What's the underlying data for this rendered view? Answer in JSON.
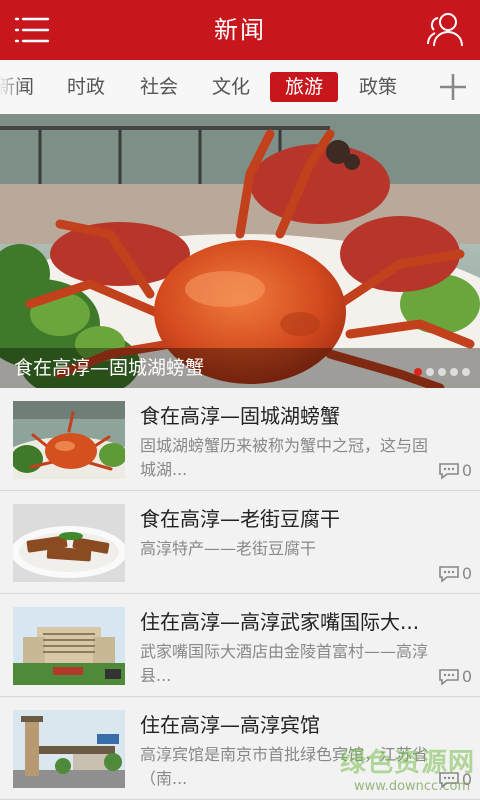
{
  "header": {
    "title": "新闻"
  },
  "tabs": [
    {
      "label": "新闻"
    },
    {
      "label": "时政"
    },
    {
      "label": "社会"
    },
    {
      "label": "文化"
    },
    {
      "label": "旅游",
      "active": true
    },
    {
      "label": "政策"
    }
  ],
  "banner": {
    "caption": "食在高淳—固城湖螃蟹",
    "slide_count": 5,
    "active_slide": 1
  },
  "articles": [
    {
      "title": "食在高淳—固城湖螃蟹",
      "summary": "固城湖螃蟹历来被称为蟹中之冠，这与固城湖...",
      "comments": "0",
      "thumb": "crab-dish"
    },
    {
      "title": "食在高淳—老街豆腐干",
      "summary": "高淳特产——老街豆腐干",
      "comments": "0",
      "thumb": "tofu-dish"
    },
    {
      "title": "住在高淳—高淳武家嘴国际大...",
      "summary": " 武家嘴国际大酒店由金陵首富村——高淳县...",
      "comments": "0",
      "thumb": "hotel-building"
    },
    {
      "title": "住在高淳—高淳宾馆",
      "summary": "高淳宾馆是南京市首批绿色宾馆，江苏省（南...",
      "comments": "0",
      "thumb": "hotel-gate"
    }
  ],
  "watermark": {
    "line1": "绿色资源网",
    "line2": "www.downcc.com"
  },
  "colors": {
    "brand_red": "#c8161d",
    "background": "#f2f2f2"
  }
}
